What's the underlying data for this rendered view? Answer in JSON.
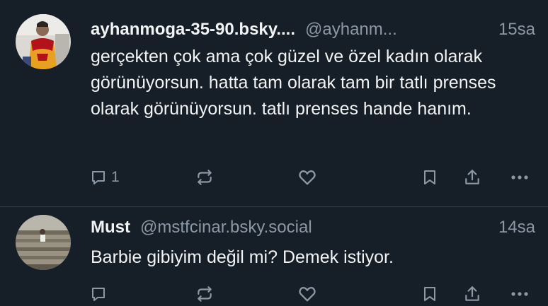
{
  "posts": [
    {
      "display_name": "ayhanmoga-35-90.bsky....",
      "handle": "@ayhanm...",
      "time": "15sa",
      "text": "gerçekten çok ama çok güzel ve özel kadın olarak görünüyorsun. hatta tam olarak tam bir tatlı prenses olarak görünüyorsun. tatlı prenses hande hanım.",
      "reply_count": "1",
      "actions": [
        "reply-icon",
        "repost-icon",
        "like-icon",
        "bookmark-icon",
        "share-icon",
        "more-icon"
      ]
    },
    {
      "display_name": "Must",
      "handle": "@mstfcinar.bsky.social",
      "time": "14sa",
      "text": "Barbie gibiyim değil mi? Demek istiyor.",
      "reply_count": "",
      "actions": [
        "reply-icon",
        "repost-icon",
        "like-icon",
        "bookmark-icon",
        "share-icon",
        "more-icon"
      ]
    }
  ],
  "colors": {
    "background": "#161e27",
    "text": "#f1f3f5",
    "muted": "#8b98a5",
    "divider": "#2e3b48"
  }
}
